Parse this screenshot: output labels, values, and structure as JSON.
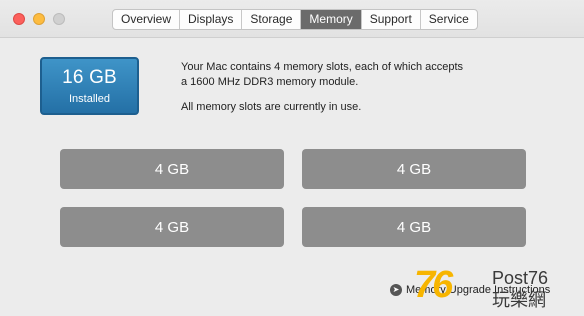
{
  "window": {
    "controls": [
      "close",
      "minimize",
      "zoom"
    ]
  },
  "tabs": [
    {
      "label": "Overview",
      "active": false
    },
    {
      "label": "Displays",
      "active": false
    },
    {
      "label": "Storage",
      "active": false
    },
    {
      "label": "Memory",
      "active": true
    },
    {
      "label": "Support",
      "active": false
    },
    {
      "label": "Service",
      "active": false
    }
  ],
  "memory": {
    "total": "16 GB",
    "status": "Installed",
    "description_line1": "Your Mac contains 4 memory slots, each of which accepts",
    "description_line2": "a 1600 MHz DDR3 memory module.",
    "slots_status": "All memory slots are currently in use.",
    "slots": [
      "4 GB",
      "4 GB",
      "4 GB",
      "4 GB"
    ]
  },
  "link": {
    "label": "Memory Upgrade Instructions",
    "icon": "arrow-circle-icon"
  },
  "watermark": {
    "number": "76",
    "text_top": "Post76",
    "text_bottom": "玩樂網"
  },
  "colors": {
    "badge": "#2e82b9",
    "slot": "#8d8d8d",
    "active_tab": "#6b6b6b"
  }
}
